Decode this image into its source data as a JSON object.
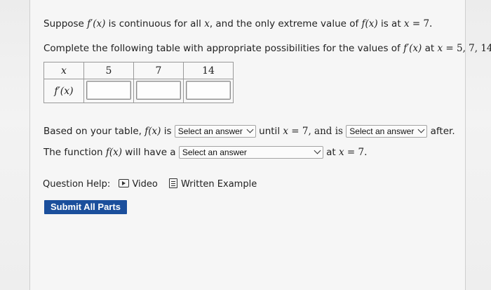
{
  "question": {
    "line1": {
      "t1": "Suppose ",
      "m1": "f′(x)",
      "t2": " is continuous for all ",
      "m2": "x",
      "t3": ", and the only extreme value of ",
      "m3": "f(x)",
      "t4": " is at ",
      "m4": "x",
      "t5": " = 7."
    },
    "line2": {
      "t1": "Complete the following table with appropriate possibilities for the values of ",
      "m1": "f′(x)",
      "t2": " at ",
      "m2": "x",
      "t3": " = 5, 7, 14.."
    }
  },
  "table": {
    "header_label": "x",
    "row_label": "f′(x)",
    "x_values": [
      "5",
      "7",
      "14"
    ],
    "answers": [
      "",
      "",
      ""
    ]
  },
  "sentence1": {
    "t1": "Based on your table, ",
    "m1": "f(x)",
    "t2": " is ",
    "select1": "Select an answer",
    "t3": " until ",
    "m2": "x",
    "t4": " = 7, and is ",
    "select2": "Select an answer",
    "t5": " after."
  },
  "sentence2": {
    "t1": "The function ",
    "m1": "f(x)",
    "t2": " will have a ",
    "select3": "Select an answer",
    "t3": " at ",
    "m2": "x",
    "t4": " = 7."
  },
  "help": {
    "label": "Question Help:",
    "video": "Video",
    "example": "Written Example"
  },
  "submit_label": "Submit All Parts",
  "colors": {
    "submit_bg": "#1b4f9c"
  }
}
